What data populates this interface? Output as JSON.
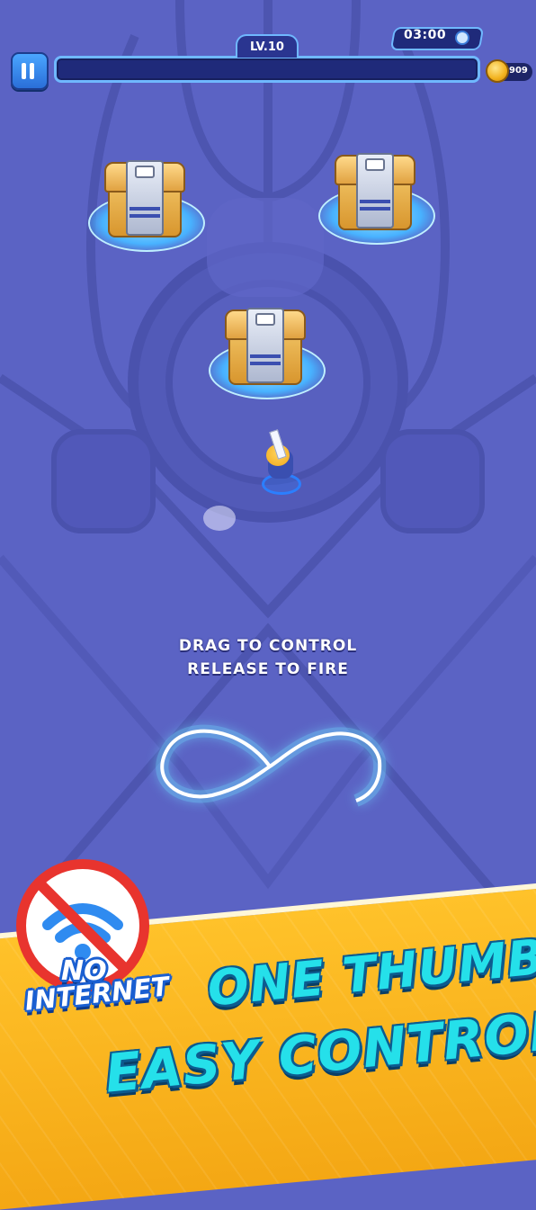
{
  "hud": {
    "level_label": "LV.10",
    "timer_text": "03:00",
    "coin_count": "909",
    "progress_fraction": 0.0
  },
  "icons": {
    "pause": "pause-icon",
    "clock": "clock-icon",
    "coin": "coin-icon",
    "no_wifi": "no-wifi-icon"
  },
  "tutorial": {
    "line1": "DRAG TO CONTROL",
    "line2": "RELEASE TO FIRE"
  },
  "badge": {
    "line1": "NO",
    "line2": "INTERNET"
  },
  "promo": {
    "line1": "ONE THUMB",
    "line2": "EASY CONTROL"
  },
  "colors": {
    "floor": "#5b63c4",
    "banner": "#f4a714",
    "promo_text": "#25e0ea",
    "trail_glow": "#bff2ff",
    "no_sign_red": "#e8342e"
  }
}
